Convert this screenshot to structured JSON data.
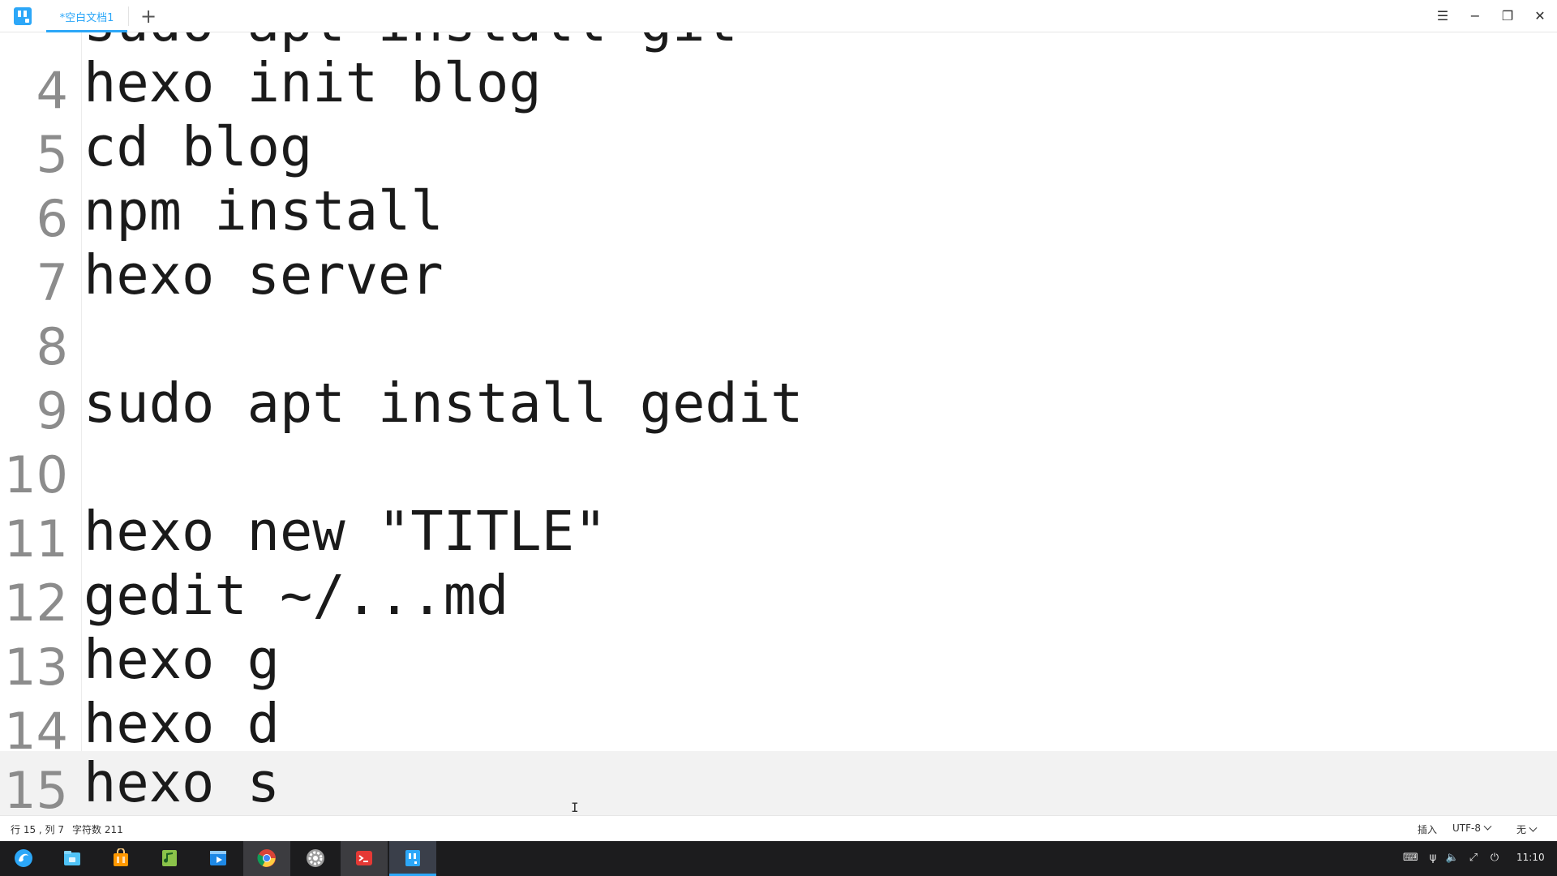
{
  "window": {
    "tab_title": "*空白文档1",
    "add_tab": "+",
    "controls": {
      "menu": "☰",
      "minimize": "−",
      "maximize": "❐",
      "close": "✕"
    }
  },
  "editor": {
    "lines": [
      {
        "num": "4",
        "text": "hexo init blog"
      },
      {
        "num": "5",
        "text": "cd blog"
      },
      {
        "num": "6",
        "text": "npm install"
      },
      {
        "num": "7",
        "text": "hexo server"
      },
      {
        "num": "8",
        "text": ""
      },
      {
        "num": "9",
        "text": "sudo apt install gedit"
      },
      {
        "num": "10",
        "text": ""
      },
      {
        "num": "11",
        "text": "hexo new \"TITLE\""
      },
      {
        "num": "12",
        "text": "gedit ~/...md"
      },
      {
        "num": "13",
        "text": "hexo g"
      },
      {
        "num": "14",
        "text": "hexo d"
      },
      {
        "num": "15",
        "text": "hexo s"
      }
    ]
  },
  "statusbar": {
    "cursor_pos": "行 15 , 列 7",
    "char_count": "字符数 211",
    "mode": "插入",
    "encoding": "UTF-8",
    "highlight": "无"
  },
  "taskbar": {
    "apps": [
      {
        "name": "launcher",
        "icon": "deepin-launcher-icon"
      },
      {
        "name": "file-manager",
        "icon": "file-manager-icon"
      },
      {
        "name": "app-store",
        "icon": "app-store-icon"
      },
      {
        "name": "music",
        "icon": "music-icon"
      },
      {
        "name": "movie",
        "icon": "movie-icon"
      },
      {
        "name": "chrome",
        "icon": "chrome-icon"
      },
      {
        "name": "settings",
        "icon": "settings-icon"
      },
      {
        "name": "terminal",
        "icon": "terminal-icon"
      },
      {
        "name": "text-editor",
        "icon": "text-editor-icon"
      }
    ],
    "tray": [
      "keyboard-icon",
      "usb-icon",
      "volume-icon",
      "network-icon",
      "power-icon"
    ],
    "time": "11:10"
  },
  "colors": {
    "accent": "#2ca7f8",
    "taskbar_bg": "#1c1c1e"
  }
}
